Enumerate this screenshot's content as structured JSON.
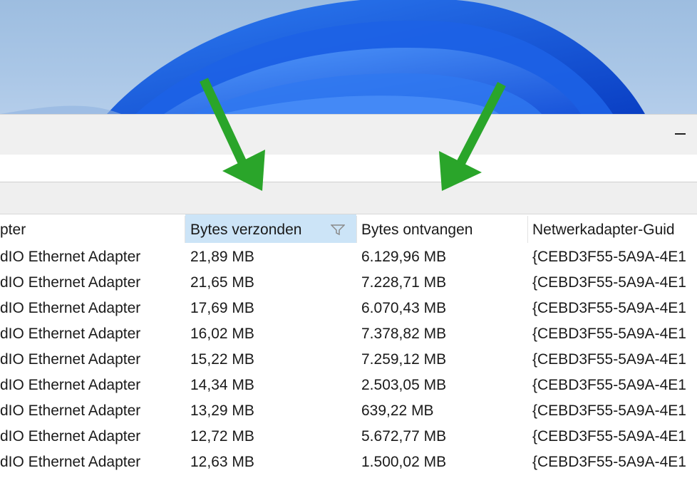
{
  "window": {
    "filter_value": ""
  },
  "table": {
    "headers": [
      "pter",
      "Bytes verzonden",
      "Bytes ontvangen",
      "Netwerkadapter-Guid"
    ],
    "rows": [
      [
        "dIO Ethernet Adapter",
        "21,89 MB",
        "6.129,96 MB",
        "{CEBD3F55-5A9A-4E1"
      ],
      [
        "dIO Ethernet Adapter",
        "21,65 MB",
        "7.228,71 MB",
        "{CEBD3F55-5A9A-4E1"
      ],
      [
        "dIO Ethernet Adapter",
        "17,69 MB",
        "6.070,43 MB",
        "{CEBD3F55-5A9A-4E1"
      ],
      [
        "dIO Ethernet Adapter",
        "16,02 MB",
        "7.378,82 MB",
        "{CEBD3F55-5A9A-4E1"
      ],
      [
        "dIO Ethernet Adapter",
        "15,22 MB",
        "7.259,12 MB",
        "{CEBD3F55-5A9A-4E1"
      ],
      [
        "dIO Ethernet Adapter",
        "14,34 MB",
        "2.503,05 MB",
        "{CEBD3F55-5A9A-4E1"
      ],
      [
        "dIO Ethernet Adapter",
        "13,29 MB",
        "639,22 MB",
        "{CEBD3F55-5A9A-4E1"
      ],
      [
        "dIO Ethernet Adapter",
        "12,72 MB",
        "5.672,77 MB",
        "{CEBD3F55-5A9A-4E1"
      ],
      [
        "dIO Ethernet Adapter",
        "12,63 MB",
        "1.500,02 MB",
        "{CEBD3F55-5A9A-4E1"
      ]
    ],
    "sorted_column": "Bytes verzonden"
  },
  "colors": {
    "arrow": "#2aa52a",
    "sorted_header_bg": "#cce4f7",
    "wallpaper_blue": "#1f5fe0"
  },
  "icons": [
    "minimize-icon",
    "filter-icon",
    "arrow-annotation"
  ]
}
